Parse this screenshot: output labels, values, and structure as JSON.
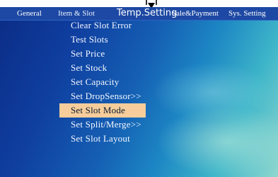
{
  "menubar": {
    "tabs": [
      {
        "label": "General"
      },
      {
        "label": "Item & Slot"
      },
      {
        "label": "Temp.Setting"
      },
      {
        "label": "Sale&Payment"
      },
      {
        "label": "Sys. Setting"
      }
    ],
    "active_tab": "Item & Slot"
  },
  "menu": {
    "items": [
      {
        "label": "Clear Slot Error"
      },
      {
        "label": "Test Slots"
      },
      {
        "label": "Set Price"
      },
      {
        "label": "Set Stock"
      },
      {
        "label": "Set Capacity"
      },
      {
        "label": "Set DropSensor>>"
      },
      {
        "label": "Set Slot Mode"
      },
      {
        "label": "Set Split/Merge>>"
      },
      {
        "label": "Set Slot Layout"
      }
    ],
    "selected_item": "Set Slot Mode"
  },
  "colors": {
    "menubar_bg": "#1d48a3",
    "selection_bg": "#f6cd9b",
    "text": "#ffffff"
  },
  "icons": {
    "top_marker": "down-arrow-icon"
  }
}
